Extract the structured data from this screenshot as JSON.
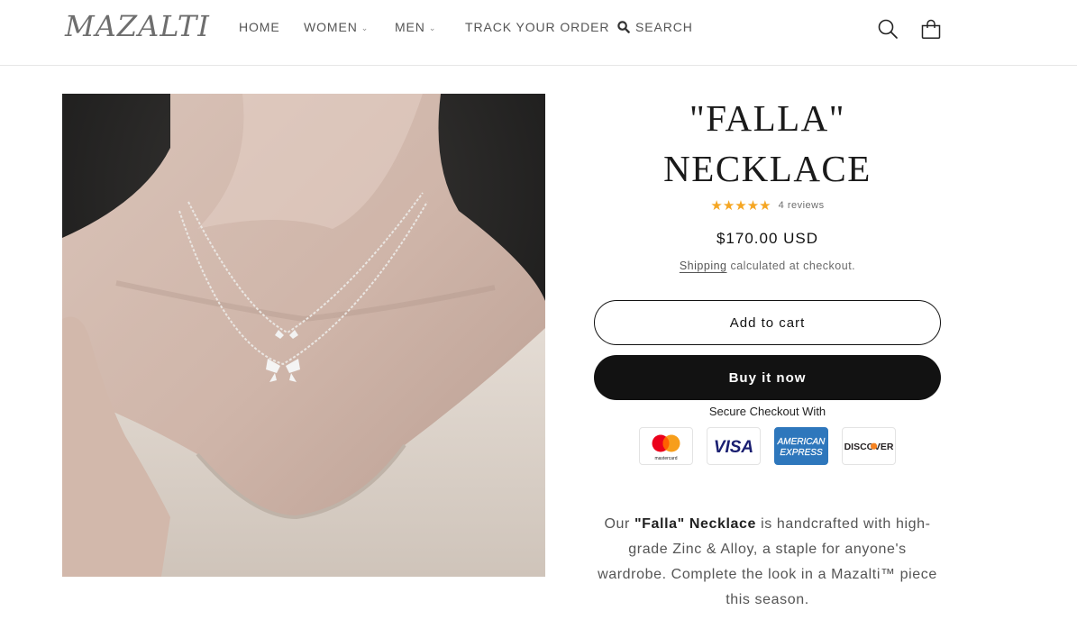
{
  "header": {
    "logo": "MAZALTI",
    "nav": [
      {
        "label": "HOME",
        "has_dropdown": false
      },
      {
        "label": "WOMEN",
        "has_dropdown": true
      },
      {
        "label": "MEN",
        "has_dropdown": true
      },
      {
        "label": "TRACK YOUR ORDER",
        "has_dropdown": false
      }
    ],
    "search_label": "SEARCH",
    "icons": [
      "search-icon",
      "cart-icon"
    ]
  },
  "product": {
    "title_line1": "\"FALLA\"",
    "title_line2": "NECKLACE",
    "rating": 5,
    "stars": "★★★★★",
    "reviews_label": "4 reviews",
    "price": "$170.00 USD",
    "shipping_link": "Shipping",
    "shipping_text": " calculated at checkout.",
    "add_to_cart": "Add to cart",
    "buy_now": "Buy it now",
    "secure_checkout": "Secure Checkout With",
    "payment_methods": [
      {
        "name": "mastercard",
        "label": "mastercard"
      },
      {
        "name": "visa",
        "label": "VISA"
      },
      {
        "name": "american-express",
        "label_line1": "AMERICAN",
        "label_line2": "EXPRESS"
      },
      {
        "name": "discover",
        "label": "DISCOVER"
      }
    ],
    "description": {
      "prefix": "Our ",
      "bold": "\"Falla\" Necklace",
      "rest": " is handcrafted with high-grade Zinc & Alloy, a staple for anyone's wardrobe. Complete the look in a Mazalti™ piece this season."
    }
  },
  "colors": {
    "accent_star": "#f5a623",
    "button_dark": "#121212",
    "text_muted": "#6b6b6b"
  }
}
